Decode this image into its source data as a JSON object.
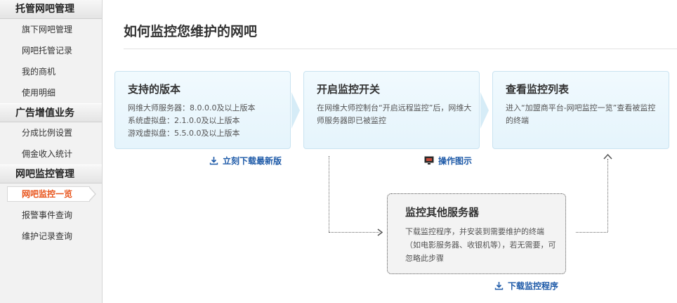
{
  "sidebar": {
    "sections": [
      {
        "title": "托管网吧管理",
        "items": [
          "旗下网吧管理",
          "网吧托管记录",
          "我的商机",
          "使用明细"
        ]
      },
      {
        "title": "广告增值业务",
        "items": [
          "分成比例设置",
          "佣金收入统计"
        ]
      },
      {
        "title": "网吧监控管理",
        "items": [
          "网吧监控一览",
          "报警事件查询",
          "维护记录查询"
        ]
      }
    ]
  },
  "main": {
    "title": "如何监控您维护的网吧",
    "step1": {
      "title": "支持的版本",
      "lines": [
        "网维大师服务器：8.0.0.0及以上版本",
        "系统虚拟盘：2.1.0.0及以上版本",
        "游戏虚拟盘：5.5.0.0及以上版本"
      ]
    },
    "step2": {
      "title": "开启监控开关",
      "text": "在网维大师控制台“开启远程监控”后，网维大师服务器即已被监控"
    },
    "step3": {
      "title": "查看监控列表",
      "text": "进入“加盟商平台-网吧监控一览”查看被监控的终端"
    },
    "step_other": {
      "title": "监控其他服务器",
      "text": "下载监控程序，并安装到需要维护的终端（如电影服务器、收银机等），若无需要，可忽略此步骤"
    },
    "links": {
      "download_latest": "立刻下载最新版",
      "guide": "操作图示",
      "download_monitor": "下载监控程序"
    }
  },
  "colors": {
    "active": "#e8541b",
    "link": "#1e5aa8",
    "card_bg": "#e9f6fd",
    "card_border": "#c9e3f1"
  }
}
